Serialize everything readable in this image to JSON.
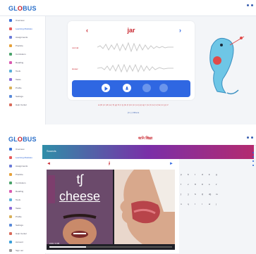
{
  "colors": {
    "brand_blue": "#2a6fc9",
    "brand_red": "#c8232c",
    "accent": "#2f67e2",
    "panel_bg": "#f3f5f8"
  },
  "panel1": {
    "logo_left": "GL",
    "logo_mid": "O",
    "logo_right": "BUS",
    "sidebar": [
      {
        "label": "Overview",
        "icon": "home-icon",
        "color": "#3a6fd8",
        "active": false
      },
      {
        "label": "Learning Modules",
        "icon": "book-icon",
        "color": "#e65a5a",
        "active": true
      },
      {
        "label": "Assignments",
        "icon": "clipboard-icon",
        "color": "#6b7bd8",
        "active": false
      },
      {
        "label": "Practice",
        "icon": "pencil-icon",
        "color": "#e6a13a",
        "active": false
      },
      {
        "label": "Curriculum",
        "icon": "grid-icon",
        "color": "#4aa36b",
        "active": false
      },
      {
        "label": "Reading",
        "icon": "reader-icon",
        "color": "#d85ab0",
        "active": false
      },
      {
        "label": "Tools",
        "icon": "wrench-icon",
        "color": "#5ab0d8",
        "active": false
      },
      {
        "label": "Tasks",
        "icon": "list-icon",
        "color": "#8a6bd8",
        "active": false
      },
      {
        "label": "Profile",
        "icon": "user-icon",
        "color": "#d8b05a",
        "active": false
      },
      {
        "label": "Settings",
        "icon": "gear-icon",
        "color": "#5a8ad8",
        "active": false
      },
      {
        "label": "Help Center",
        "icon": "help-icon",
        "color": "#d86b5a",
        "active": false
      }
    ],
    "word": "jar",
    "prev_arrow": "‹",
    "next_arrow": "›",
    "label_normal": "normal",
    "label_slow": "slower",
    "alphabet": "a | b | c | d | e | f | g | h | i | j | k | l | m | n | o | p | q | r | s | t | u | v | w | x | y | z",
    "footer_link": "[ b ] | Others"
  },
  "panel2": {
    "logo_left": "GL",
    "logo_mid": "O",
    "logo_right": "BUS",
    "center_logo": "ধ্বনি शिक्षा",
    "banner_title": "Sounds",
    "phoneme": "tʃ",
    "example_word": "cheese",
    "video_time": "0:00 / 0:05",
    "sidebar": [
      {
        "label": "Overview",
        "icon": "home-icon",
        "color": "#3a6fd8",
        "active": false
      },
      {
        "label": "Learning Modules",
        "icon": "book-icon",
        "color": "#e65a5a",
        "active": true
      },
      {
        "label": "Assignments",
        "icon": "clipboard-icon",
        "color": "#6b7bd8",
        "active": false
      },
      {
        "label": "Practice",
        "icon": "pencil-icon",
        "color": "#e6a13a",
        "active": false
      },
      {
        "label": "Curriculum",
        "icon": "grid-icon",
        "color": "#4aa36b",
        "active": false
      },
      {
        "label": "Reading",
        "icon": "reader-icon",
        "color": "#d85ab0",
        "active": false
      },
      {
        "label": "Tools",
        "icon": "wrench-icon",
        "color": "#5ab0d8",
        "active": false
      },
      {
        "label": "Tasks",
        "icon": "list-icon",
        "color": "#8a6bd8",
        "active": false
      },
      {
        "label": "Profile",
        "icon": "user-icon",
        "color": "#d8b05a",
        "active": false
      },
      {
        "label": "Settings",
        "icon": "gear-icon",
        "color": "#5a8ad8",
        "active": false
      },
      {
        "label": "Help Center",
        "icon": "help-icon",
        "color": "#d86b5a",
        "active": false
      },
      {
        "label": "Account",
        "icon": "account-icon",
        "color": "#3a9fd8",
        "active": false
      },
      {
        "label": "Sign out",
        "icon": "logout-icon",
        "color": "#999999",
        "active": false
      }
    ],
    "phoneme_grid": [
      "p",
      "b",
      "t",
      "d",
      "k",
      "g",
      "f",
      "v",
      "θ",
      "ð",
      "s",
      "z",
      "ʃ",
      "ʒ",
      "h",
      "tʃ",
      "dʒ",
      "m",
      "n",
      "ŋ",
      "l",
      "r",
      "w",
      "j"
    ]
  }
}
